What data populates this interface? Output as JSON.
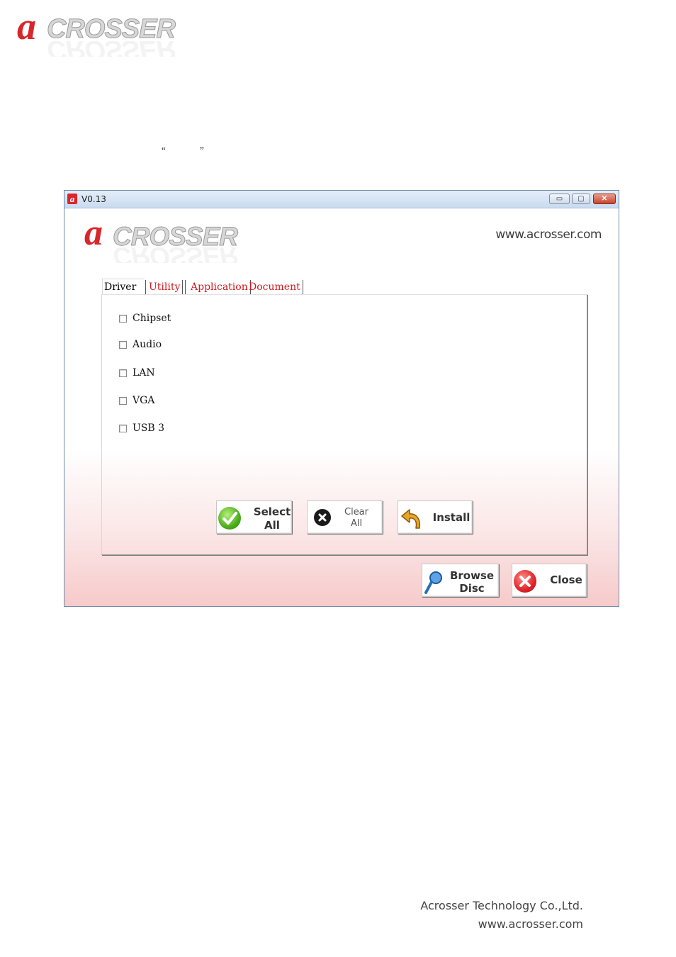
{
  "page_logo": {
    "letter": "a",
    "text": "CROSSER"
  },
  "page_quotes": {
    "open": "“",
    "close": "”"
  },
  "window": {
    "title": "V0.13",
    "controls": {
      "minimize": "▭",
      "maximize": "▢",
      "close": "✕"
    },
    "logo": {
      "letter": "a",
      "text": "CROSSER"
    },
    "url": "www.acrosser.com",
    "tabs": [
      "Driver",
      "Utility",
      "Application",
      "Document"
    ],
    "drivers": [
      {
        "label": "Chipset",
        "checked": false
      },
      {
        "label": "Audio",
        "checked": false
      },
      {
        "label": "LAN",
        "checked": false
      },
      {
        "label": "VGA",
        "checked": false
      },
      {
        "label": "USB 3",
        "checked": false
      }
    ],
    "buttons": {
      "select_all": [
        "Select",
        "All"
      ],
      "clear_all": [
        "Clear",
        "All"
      ],
      "install": "Install",
      "browse_disc": [
        "Browse",
        "Disc"
      ],
      "close": "Close"
    },
    "colors": {
      "brand_red": "#d9252b",
      "tab_red": "#d01b20",
      "footer_pink": "#f6caca"
    }
  },
  "footer": {
    "company": "Acrosser Technology Co.,Ltd.",
    "url": "www.acrosser.com"
  }
}
